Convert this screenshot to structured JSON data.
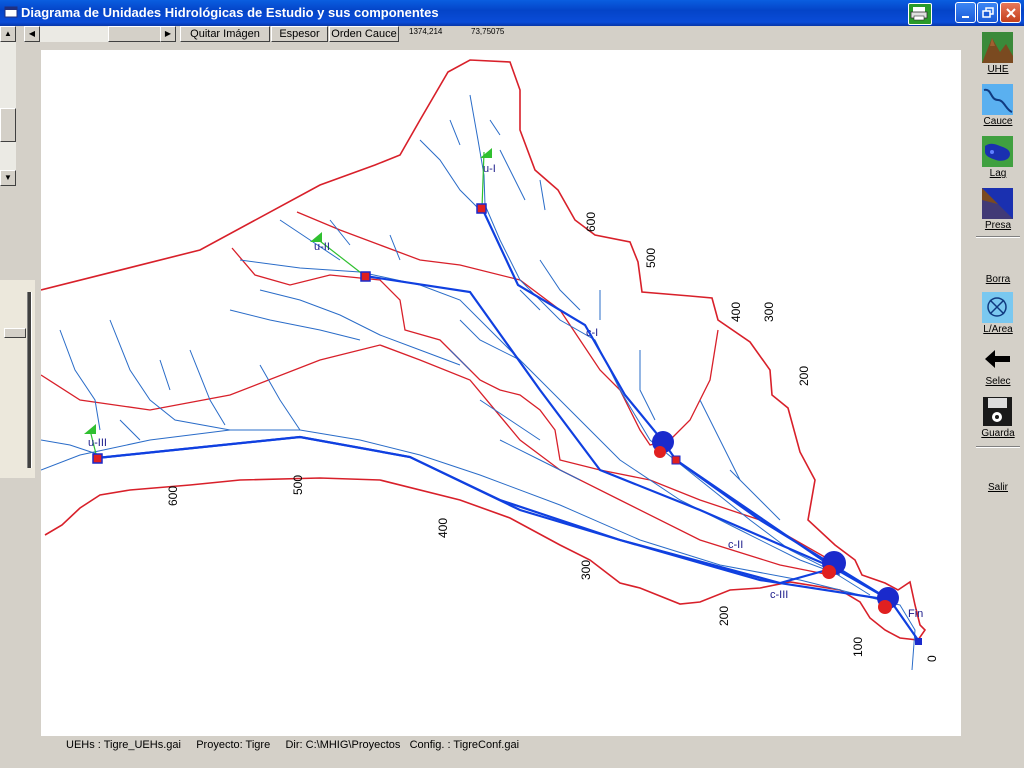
{
  "window": {
    "title": "Diagrama de Unidades Hidrológicas de Estudio y sus componentes",
    "buttons": {
      "minimize": "minimize",
      "restore": "restore",
      "close": "close"
    }
  },
  "toolbar": {
    "remove_image": "Quitar Imágen",
    "thickness": "Espesor",
    "order": "Orden Cauce",
    "coord_x": "1374,214",
    "coord_y": "73,75075"
  },
  "map": {
    "units": [
      {
        "label": "u-I"
      },
      {
        "label": "u-II"
      },
      {
        "label": "u-III"
      }
    ],
    "channels": [
      {
        "label": "c-I"
      },
      {
        "label": "c-II"
      },
      {
        "label": "c-III"
      }
    ],
    "end_label": "Fin",
    "contours": [
      "600",
      "500",
      "400",
      "300",
      "200",
      "100",
      "0",
      "600",
      "500",
      "400",
      "300",
      "200"
    ]
  },
  "sidebar": {
    "items": [
      {
        "label": "UHE",
        "icon": "mountain-icon"
      },
      {
        "label": "Cauce",
        "icon": "river-icon"
      },
      {
        "label": "Lag",
        "icon": "lake-icon"
      },
      {
        "label": "Presa",
        "icon": "dam-icon"
      },
      {
        "label": "Borra",
        "icon": ""
      },
      {
        "label": "L/Area",
        "icon": "area-icon"
      },
      {
        "label": "Selec",
        "icon": "arrow-left-icon"
      },
      {
        "label": "Guarda",
        "icon": "disk-icon"
      },
      {
        "label": "Salir",
        "icon": ""
      }
    ]
  },
  "status": {
    "uehs": "UEHs : Tigre_UEHs.gai",
    "project": "Proyecto: Tigre",
    "dir": "Dir: C:\\MHIG\\Proyectos",
    "config": "Config. : TigreConf.gai"
  },
  "colors": {
    "boundary": "#d8202a",
    "river": "#2a6cc8",
    "link": "#1040e0",
    "titlebar": "#0a4cd8"
  }
}
